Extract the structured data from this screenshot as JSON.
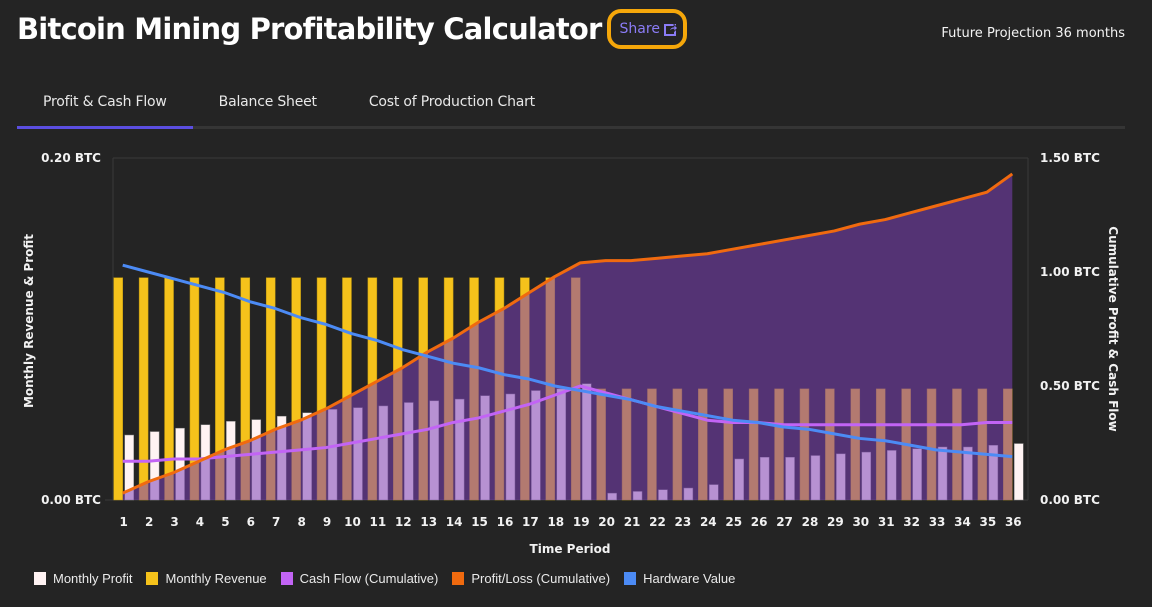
{
  "header": {
    "title": "Bitcoin Mining Profitability Calculator",
    "share_label": "Share",
    "share_icon": "share-external-icon",
    "projection_label": "Future Projection 36 months"
  },
  "tabs": [
    {
      "label": "Profit & Cash Flow",
      "active": true
    },
    {
      "label": "Balance Sheet",
      "active": false
    },
    {
      "label": "Cost of Production Chart",
      "active": false
    }
  ],
  "colors": {
    "monthly_profit": "#fff3f3",
    "monthly_revenue": "#f5c21b",
    "cash_flow": "#c264f5",
    "profit_loss": "#f06a0f",
    "hardware_value": "#4c8bf5",
    "profit_area_fill": "#7c3fb6",
    "active_tab": "#5b4ee0",
    "share_link": "#8b7cf6",
    "annotation": "#f5a70a"
  },
  "chart_data": {
    "type": "bar",
    "xlabel": "Time Period",
    "ylabel_left": "Monthly Revenue & Profit",
    "ylabel_right": "Cumulative Profit & Cash Flow",
    "ylim_left": [
      0,
      0.2
    ],
    "ylim_right": [
      0,
      1.5
    ],
    "yticks_left": [
      "0.00 BTC",
      "0.20 BTC"
    ],
    "yticks_right": [
      "0.00 BTC",
      "0.50 BTC",
      "1.00 BTC",
      "1.50 BTC"
    ],
    "grid": false,
    "legend_position": "bottom",
    "categories": [
      "1",
      "2",
      "3",
      "4",
      "5",
      "6",
      "7",
      "8",
      "9",
      "10",
      "11",
      "12",
      "13",
      "14",
      "15",
      "16",
      "17",
      "18",
      "19",
      "20",
      "21",
      "22",
      "23",
      "24",
      "25",
      "26",
      "27",
      "28",
      "29",
      "30",
      "31",
      "32",
      "33",
      "34",
      "35",
      "36"
    ],
    "series": [
      {
        "name": "Monthly Profit",
        "type": "bar",
        "axis": "left",
        "values": [
          0.038,
          0.04,
          0.042,
          0.044,
          0.046,
          0.047,
          0.049,
          0.051,
          0.053,
          0.054,
          0.055,
          0.057,
          0.058,
          0.059,
          0.061,
          0.062,
          0.064,
          0.065,
          0.068,
          0.004,
          0.005,
          0.006,
          0.007,
          0.009,
          0.024,
          0.025,
          0.025,
          0.026,
          0.027,
          0.028,
          0.029,
          0.03,
          0.031,
          0.031,
          0.032,
          0.033
        ]
      },
      {
        "name": "Monthly Revenue",
        "type": "bar",
        "axis": "left",
        "values": [
          0.13,
          0.13,
          0.13,
          0.13,
          0.13,
          0.13,
          0.13,
          0.13,
          0.13,
          0.13,
          0.13,
          0.13,
          0.13,
          0.13,
          0.13,
          0.13,
          0.13,
          0.13,
          0.13,
          0.065,
          0.065,
          0.065,
          0.065,
          0.065,
          0.065,
          0.065,
          0.065,
          0.065,
          0.065,
          0.065,
          0.065,
          0.065,
          0.065,
          0.065,
          0.065,
          0.065
        ]
      },
      {
        "name": "Cash Flow (Cumulative)",
        "type": "line",
        "axis": "right",
        "values": [
          0.17,
          0.17,
          0.18,
          0.18,
          0.19,
          0.2,
          0.21,
          0.22,
          0.23,
          0.25,
          0.27,
          0.29,
          0.31,
          0.34,
          0.36,
          0.39,
          0.42,
          0.46,
          0.5,
          0.47,
          0.44,
          0.41,
          0.38,
          0.35,
          0.34,
          0.34,
          0.33,
          0.33,
          0.33,
          0.33,
          0.33,
          0.33,
          0.33,
          0.33,
          0.34,
          0.34
        ]
      },
      {
        "name": "Profit/Loss (Cumulative)",
        "type": "area-line",
        "axis": "right",
        "values": [
          0.03,
          0.08,
          0.12,
          0.17,
          0.22,
          0.26,
          0.31,
          0.35,
          0.4,
          0.46,
          0.52,
          0.58,
          0.65,
          0.71,
          0.78,
          0.84,
          0.91,
          0.98,
          1.04,
          1.05,
          1.05,
          1.06,
          1.07,
          1.08,
          1.1,
          1.12,
          1.14,
          1.16,
          1.18,
          1.21,
          1.23,
          1.26,
          1.29,
          1.32,
          1.35,
          1.43
        ]
      },
      {
        "name": "Hardware Value",
        "type": "line",
        "axis": "right",
        "values": [
          1.03,
          1.0,
          0.97,
          0.94,
          0.91,
          0.87,
          0.84,
          0.8,
          0.77,
          0.73,
          0.7,
          0.66,
          0.63,
          0.6,
          0.58,
          0.55,
          0.53,
          0.5,
          0.48,
          0.46,
          0.44,
          0.41,
          0.39,
          0.37,
          0.35,
          0.34,
          0.32,
          0.31,
          0.29,
          0.27,
          0.26,
          0.24,
          0.22,
          0.21,
          0.2,
          0.19
        ]
      }
    ]
  },
  "legend": [
    {
      "label": "Monthly Profit",
      "color": "#fff3f3"
    },
    {
      "label": "Monthly Revenue",
      "color": "#f5c21b"
    },
    {
      "label": "Cash Flow (Cumulative)",
      "color": "#c264f5"
    },
    {
      "label": "Profit/Loss (Cumulative)",
      "color": "#f06a0f"
    },
    {
      "label": "Hardware Value",
      "color": "#4c8bf5"
    }
  ]
}
